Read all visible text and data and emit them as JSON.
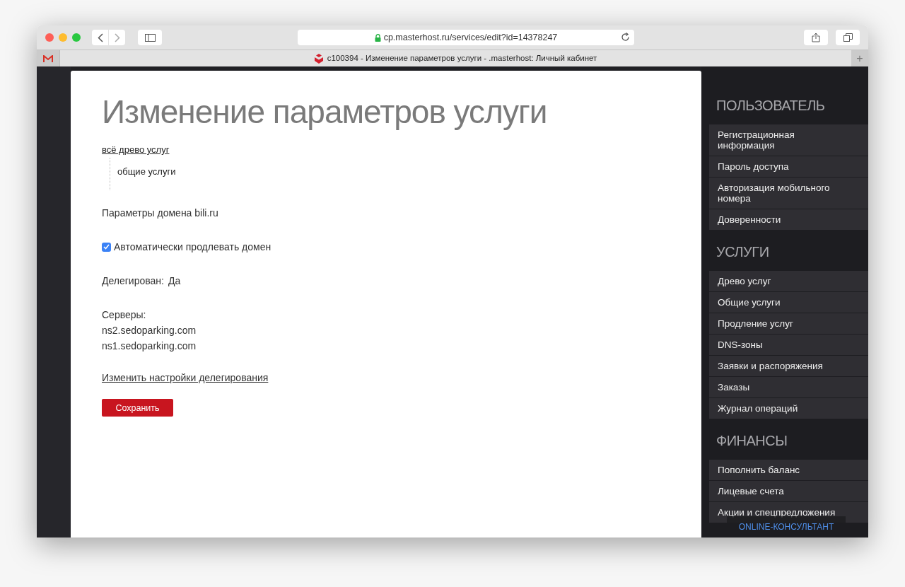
{
  "browser": {
    "url": "cp.masterhost.ru/services/edit?id=14378247",
    "tab_title": "c100394 - Изменение параметров услуги - .masterhost: Личный кабинет",
    "new_tab": "+"
  },
  "page": {
    "title": "Изменение параметров услуги",
    "breadcrumb_link": "всё древо услуг",
    "tree": [
      {
        "label": "общие услуги"
      }
    ],
    "domain_params": "Параметры домена bili.ru",
    "auto_renew": {
      "label": "Автоматически продлевать домен",
      "checked": true
    },
    "delegated": {
      "label": "Делегирован:",
      "value": "Да"
    },
    "servers": {
      "label": "Серверы:",
      "items": [
        "ns2.sedoparking.com",
        "ns1.sedoparking.com"
      ]
    },
    "change_link": "Изменить настройки делегирования",
    "save_button": "Сохранить"
  },
  "sidebar": [
    {
      "heading": "ПОЛЬЗОВАТЕЛЬ",
      "items": [
        "Регистрационная информация",
        "Пароль доступа",
        "Авторизация мобильного номера",
        "Доверенности"
      ]
    },
    {
      "heading": "УСЛУГИ",
      "items": [
        "Древо услуг",
        "Общие услуги",
        "Продление услуг",
        "DNS-зоны",
        "Заявки и распоряжения",
        "Заказы",
        "Журнал операций"
      ]
    },
    {
      "heading": "ФИНАНСЫ",
      "items": [
        "Пополнить баланс",
        "Лицевые счета",
        "Акции и спецпредложения"
      ]
    }
  ],
  "chat_button": "ONLINE-КОНСУЛЬТАНТ"
}
